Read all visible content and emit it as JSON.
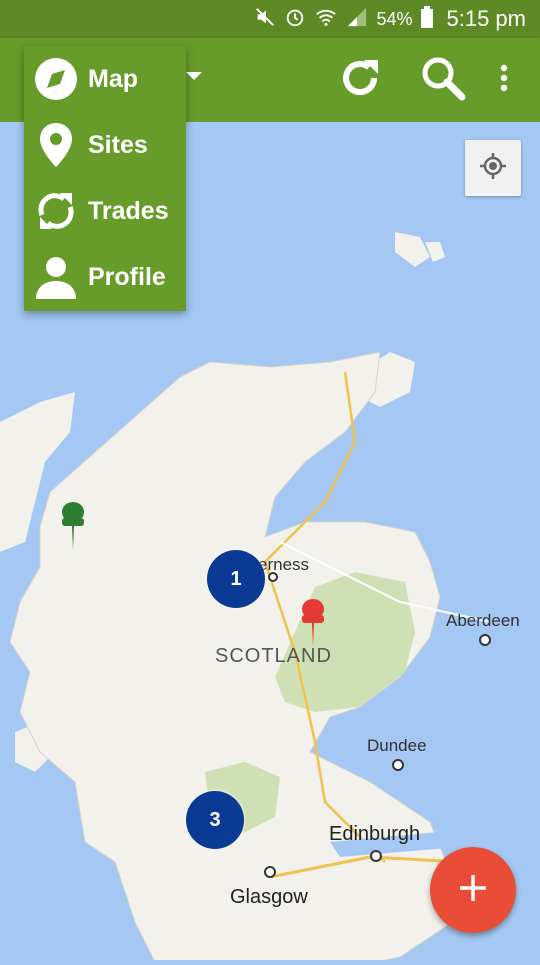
{
  "status_bar": {
    "battery": "54%",
    "time": "5:15 pm"
  },
  "menu": {
    "items": [
      {
        "label": "Map",
        "icon": "compass-icon"
      },
      {
        "label": "Sites",
        "icon": "location-pin-icon"
      },
      {
        "label": "Trades",
        "icon": "sync-icon"
      },
      {
        "label": "Profile",
        "icon": "person-icon"
      }
    ]
  },
  "map": {
    "places": {
      "inverness": "erness",
      "scotland": "SCOTLAND",
      "aberdeen": "Aberdeen",
      "dundee": "Dundee",
      "edinburgh": "Edinburgh",
      "glasgow": "Glasgow"
    },
    "clusters": {
      "north": "1",
      "south": "3"
    },
    "pins": {
      "green": "#2e7d32",
      "red": "#e53935"
    }
  },
  "colors": {
    "toolbar": "#679c2a",
    "status_bar": "#5d8a25",
    "cluster": "#0b3a94",
    "fab": "#e94d35"
  }
}
